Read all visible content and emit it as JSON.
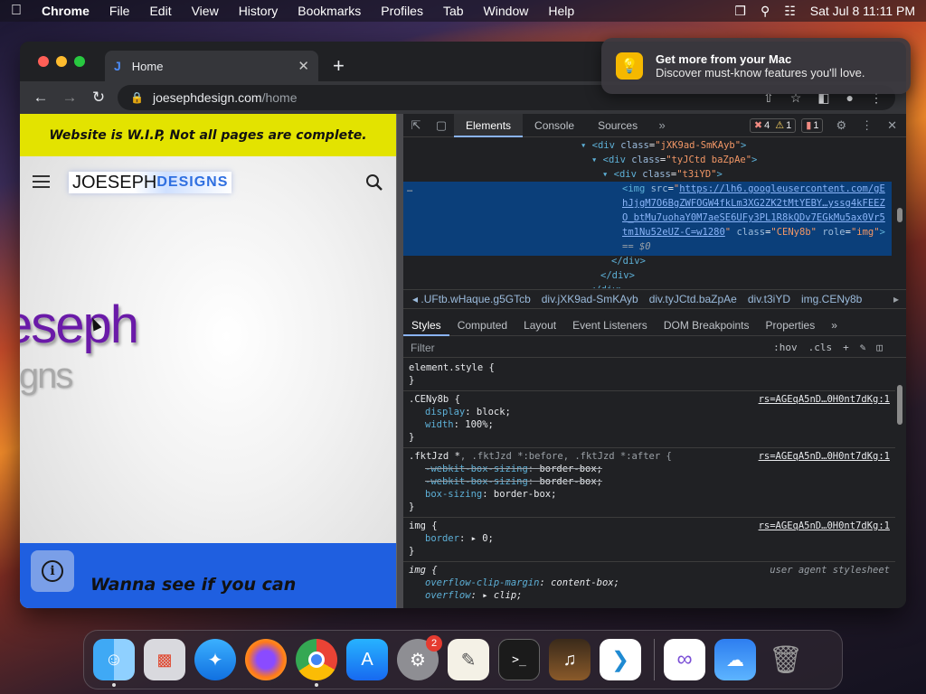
{
  "menubar": {
    "app": "Chrome",
    "items": [
      "File",
      "Edit",
      "View",
      "History",
      "Bookmarks",
      "Profiles",
      "Tab",
      "Window",
      "Help"
    ],
    "clock": "Sat Jul 8  11:11 PM"
  },
  "browser": {
    "tab_title": "Home",
    "url_host": "joesephdesign.com",
    "url_path": "/home"
  },
  "page": {
    "banner": "Website is W.I.P, Not all pages are complete.",
    "logo_part1": "JOESEPH",
    "logo_part2": "DESIGNS",
    "hero_line1": "eseph",
    "hero_line2": "igns",
    "footer_text": "Wanna see if you can",
    "info_glyph": "i"
  },
  "devtools": {
    "tabs": [
      "Elements",
      "Console",
      "Sources"
    ],
    "errors": "4",
    "warnings": "1",
    "issues": "1",
    "dom": {
      "l1_class": "jXK9ad-SmKAyb",
      "l2_class": "tyJCtd baZpAe",
      "l3_class": "t3iYD",
      "img_src": "https://lh6.googleusercontent.com/gEhJjgM7O6BgZWFOGW4fkLm3XG2ZK2tMtYEBY…yssg4kFEEZO_btMu7uohaY0M7aeSE6UFy3PL1R8kQDv7EGkMu5ax0Vr5tm1Nu52eUZ-C=w1280",
      "img_class": "CENy8b",
      "img_role": "img",
      "sel_suffix": "== $0",
      "ellipsis": "…"
    },
    "crumbs": [
      "◂ .UFtb.wHaque.g5GTcb",
      "div.jXK9ad-SmKAyb",
      "div.tyJCtd.baZpAe",
      "div.t3iYD",
      "img.CENy8b"
    ],
    "panel_tabs": [
      "Styles",
      "Computed",
      "Layout",
      "Event Listeners",
      "DOM Breakpoints",
      "Properties"
    ],
    "filter_placeholder": "Filter",
    "hov": ":hov",
    "cls": ".cls",
    "rules": {
      "element_style": "element.style {",
      "close": "}",
      "r1_sel": ".CENy8b {",
      "r1_src": "rs=AGEqA5nD…0H0nt7dKg:1",
      "r1_p1n": "display",
      "r1_p1v": "block;",
      "r1_p2n": "width",
      "r1_p2v": "100%;",
      "r2_sel": ".fktJzd *",
      "r2_sel2": ", .fktJzd *:before, .fktJzd *:after {",
      "r2_src": "rs=AGEqA5nD…0H0nt7dKg:1",
      "r2_p1n": "-webkit-box-sizing",
      "r2_p1v": "border-box;",
      "r2_p2n": "-webkit-box-sizing",
      "r2_p2v": "border-box;",
      "r2_p3n": "box-sizing",
      "r2_p3v": "border-box;",
      "r3_sel": "img {",
      "r3_src": "rs=AGEqA5nD…0H0nt7dKg:1",
      "r3_p1n": "border",
      "r3_p1v": "▸ 0;",
      "r4_sel": "img {",
      "r4_src": "user agent stylesheet",
      "r4_p1n": "overflow-clip-margin",
      "r4_p1v": "content-box;",
      "r4_p2n": "overflow",
      "r4_p2v": "▸ clip;"
    }
  },
  "notification": {
    "title": "Get more from your Mac",
    "body": "Discover must-know features you'll love."
  },
  "dock": {
    "settings_badge": "2",
    "apps": [
      "finder",
      "launchpad",
      "safari",
      "firefox",
      "chrome",
      "app-store",
      "system-settings",
      "textedit",
      "terminal",
      "instruments",
      "vscode",
      "visual-studio",
      "weather",
      "trash"
    ]
  }
}
